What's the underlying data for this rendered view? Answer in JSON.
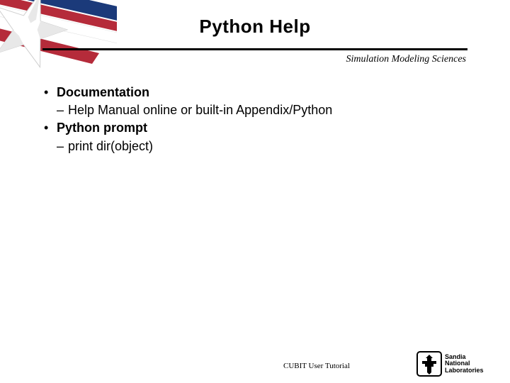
{
  "slide": {
    "title": "Python Help",
    "subtitle": "Simulation Modeling Sciences",
    "bullets": {
      "b1": "Documentation",
      "b1_sub": "Help Manual online or built-in Appendix/Python",
      "b2": "Python prompt",
      "b2_sub": "print dir(object)"
    },
    "footer": "CUBIT User Tutorial",
    "logo": {
      "line1": "Sandia",
      "line2": "National",
      "line3": "Laboratories"
    }
  }
}
